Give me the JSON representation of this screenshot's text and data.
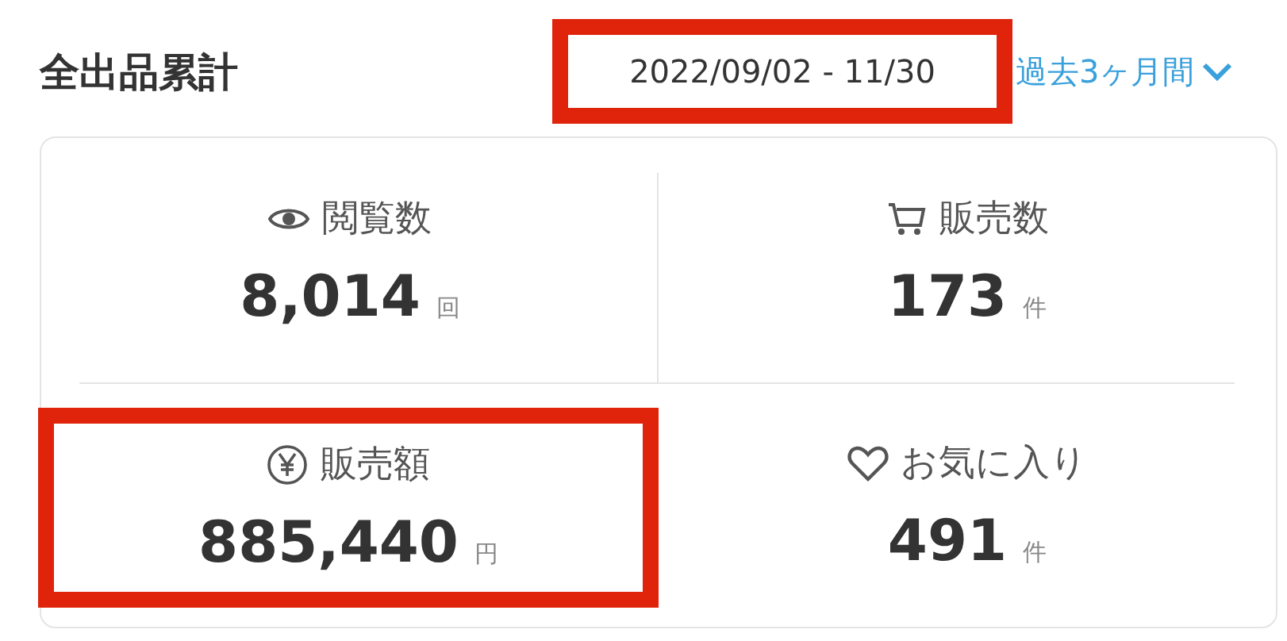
{
  "title": "全出品累計",
  "date_range": {
    "text": "2022/09/02 - 11/30",
    "highlighted": true
  },
  "period_dropdown": {
    "label": "過去3ヶ月間"
  },
  "stats": [
    {
      "kind": "views",
      "label": "閲覧数",
      "value": "8,014",
      "unit": "回",
      "highlighted": false
    },
    {
      "kind": "sales",
      "label": "販売数",
      "value": "173",
      "unit": "件",
      "highlighted": false
    },
    {
      "kind": "revenue",
      "label": "販売額",
      "value": "885,440",
      "unit": "円",
      "highlighted": true
    },
    {
      "kind": "favorites",
      "label": "お気に入り",
      "value": "491",
      "unit": "件",
      "highlighted": false
    }
  ]
}
